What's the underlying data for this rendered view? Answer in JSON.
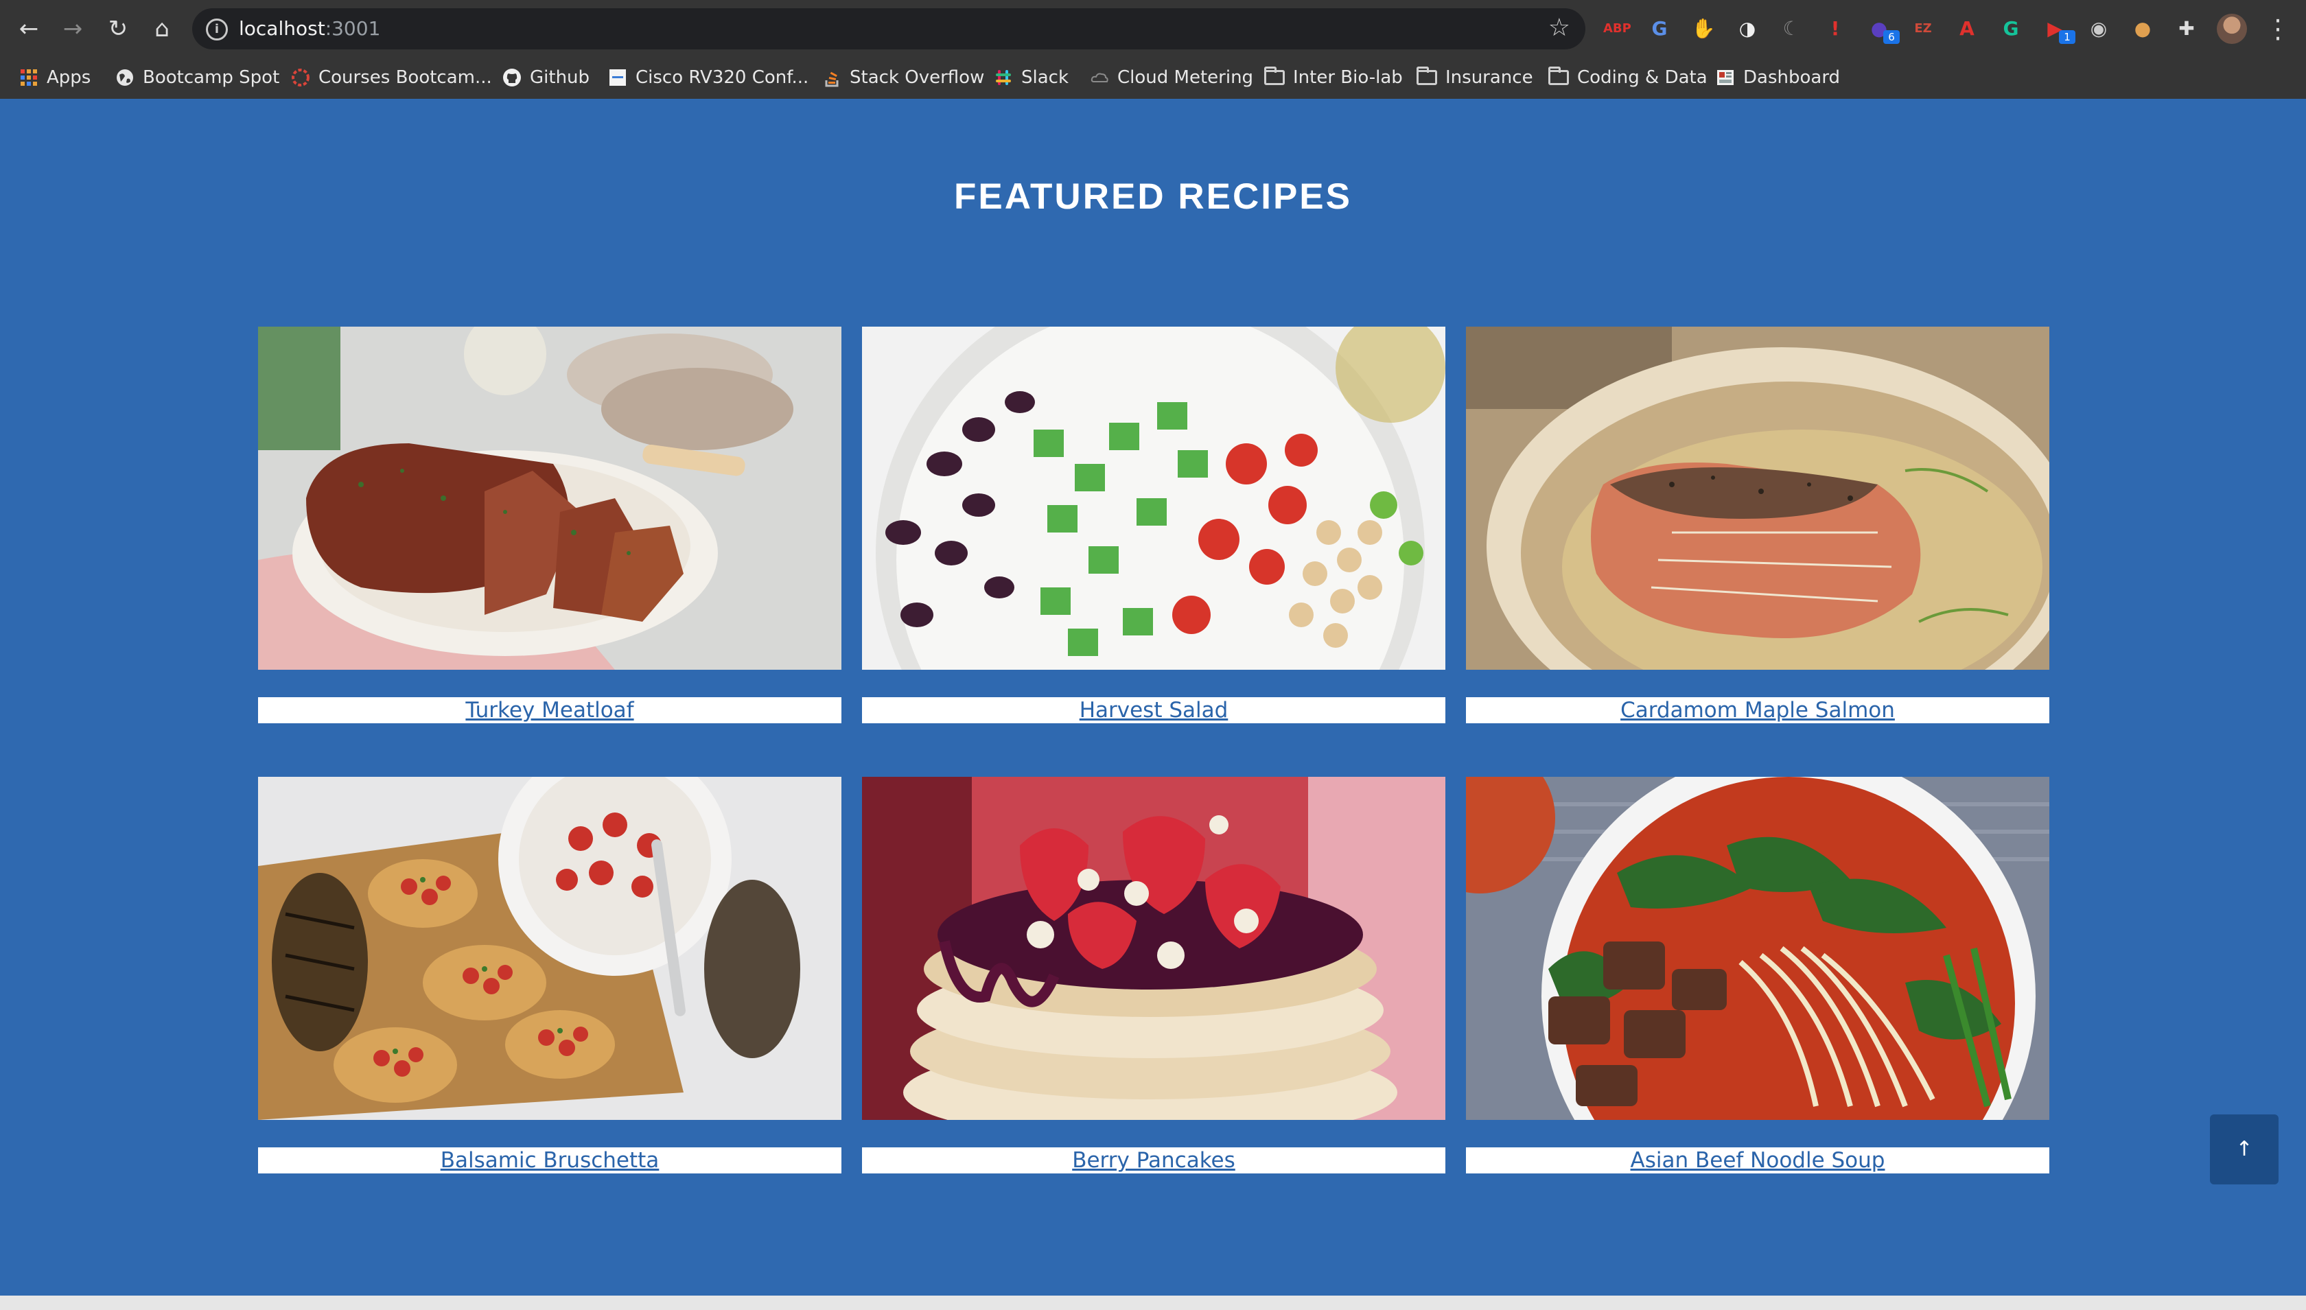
{
  "browser": {
    "url_host": "localhost",
    "url_port": ":3001",
    "bookmarks": [
      "Apps",
      "Bootcamp Spot",
      "Courses Bootcam...",
      "Github",
      "Cisco RV320 Conf...",
      "Stack Overflow",
      "Slack",
      "Cloud Metering",
      "Inter Bio-lab",
      "Insurance",
      "Coding & Data",
      "Dashboard"
    ],
    "extension_badges": {
      "ext1": "6",
      "ext2": "1"
    },
    "extensions": [
      {
        "name": "adblock-icon",
        "text": "ABP",
        "color": "#e0312d"
      },
      {
        "name": "translate-icon",
        "text": "G",
        "color": "#5b8fe8"
      },
      {
        "name": "stop-icon",
        "text": "✋",
        "color": "#e0312d"
      },
      {
        "name": "circle-ext-icon",
        "text": "◑",
        "color": "#f0f0f0"
      },
      {
        "name": "moon-ext-icon",
        "text": "☾",
        "color": "#888888"
      },
      {
        "name": "alert-ext-icon",
        "text": "!",
        "color": "#e0312d"
      },
      {
        "name": "dots-ext-icon",
        "text": "●",
        "color": "#5a3fc0"
      },
      {
        "name": "ez-ext-icon",
        "text": "EZ",
        "color": "#d04a3a"
      },
      {
        "name": "pdf-ext-icon",
        "text": "A",
        "color": "#e0312d"
      },
      {
        "name": "grammarly-icon",
        "text": "G",
        "color": "#15c39a"
      },
      {
        "name": "video-ext-icon",
        "text": "▶",
        "color": "#e0312d"
      },
      {
        "name": "camera-ext-icon",
        "text": "◉",
        "color": "#cccccc"
      },
      {
        "name": "cookie-ext-icon",
        "text": "●",
        "color": "#e0a050"
      },
      {
        "name": "puzzle-icon",
        "text": "✚",
        "color": "#dddddd"
      }
    ]
  },
  "page": {
    "title": "FEATURED RECIPES",
    "recipes": [
      "Turkey Meatloaf",
      "Harvest Salad",
      "Cardamom Maple Salmon",
      "Balsamic Bruschetta",
      "Berry Pancakes",
      "Asian Beef Noodle Soup"
    ],
    "scroll_top_label": "↑"
  },
  "colors": {
    "page_bg": "#2f69b0",
    "label_bg": "#ffffff",
    "link": "#2a64aa",
    "scroll_button": "#1c4c86"
  }
}
